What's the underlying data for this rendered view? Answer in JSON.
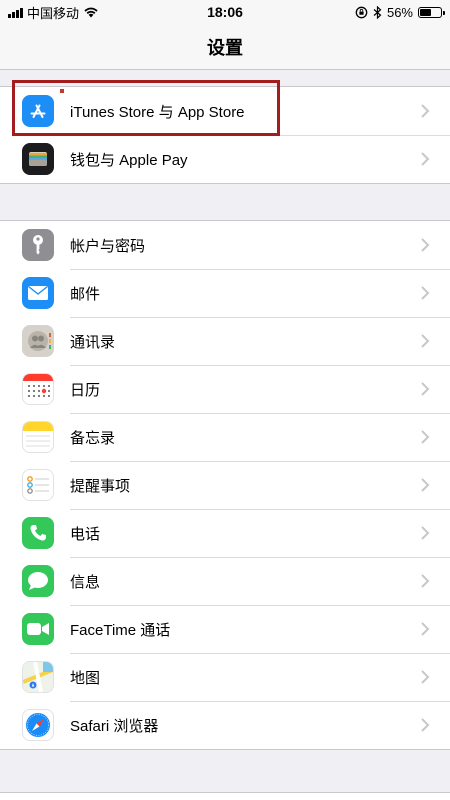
{
  "status_bar": {
    "carrier": "中国移动",
    "time": "18:06",
    "battery_percent": "56%",
    "battery_level": 0.56
  },
  "nav": {
    "title": "设置"
  },
  "group1": [
    {
      "label": "iTunes Store 与 App Store",
      "icon": "app-store-icon",
      "color": "#1e8ef7"
    },
    {
      "label": "钱包与 Apple Pay",
      "icon": "wallet-icon",
      "color": "#1c1c1e"
    }
  ],
  "group2": [
    {
      "label": "帐户与密码",
      "icon": "key-icon",
      "color": "#8e8e93"
    },
    {
      "label": "邮件",
      "icon": "mail-icon",
      "color": "#1e8ef7"
    },
    {
      "label": "通讯录",
      "icon": "contacts-icon",
      "color": "#c8c4bd"
    },
    {
      "label": "日历",
      "icon": "calendar-icon",
      "color": "#ffffff"
    },
    {
      "label": "备忘录",
      "icon": "notes-icon",
      "color": "#ffffff"
    },
    {
      "label": "提醒事项",
      "icon": "reminders-icon",
      "color": "#ffffff"
    },
    {
      "label": "电话",
      "icon": "phone-icon",
      "color": "#34c759"
    },
    {
      "label": "信息",
      "icon": "messages-icon",
      "color": "#34c759"
    },
    {
      "label": "FaceTime 通话",
      "icon": "facetime-icon",
      "color": "#34c759"
    },
    {
      "label": "地图",
      "icon": "maps-icon",
      "color": "#e8f1e4"
    },
    {
      "label": "Safari 浏览器",
      "icon": "safari-icon",
      "color": "#ffffff"
    }
  ],
  "colors": {
    "highlight_box": "#a31d1f",
    "background": "#efeff4"
  }
}
